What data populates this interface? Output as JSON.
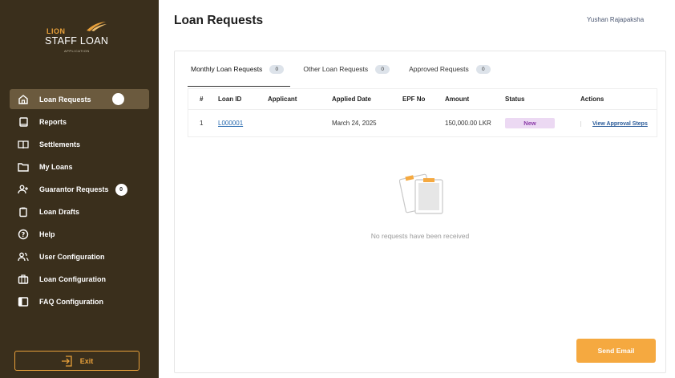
{
  "brand": {
    "top": "LION",
    "title": "STAFF  LOAN",
    "sub": "APPLICATION"
  },
  "sidebar": {
    "items": [
      {
        "label": "Loan Requests",
        "icon": "home-icon",
        "active": true
      },
      {
        "label": "Reports",
        "icon": "book-icon"
      },
      {
        "label": "Settlements",
        "icon": "open-book-icon"
      },
      {
        "label": "My Loans",
        "icon": "folder-icon"
      },
      {
        "label": "Guarantor Requests",
        "icon": "user-plus-icon",
        "badge": "0"
      },
      {
        "label": "Loan Drafts",
        "icon": "clipboard-icon"
      },
      {
        "label": "Help",
        "icon": "help-icon"
      },
      {
        "label": "User Configuration",
        "icon": "users-icon"
      },
      {
        "label": "Loan Configuration",
        "icon": "briefcase-icon"
      },
      {
        "label": "FAQ Configuration",
        "icon": "sidebar-panel-icon"
      }
    ],
    "exit_label": "Exit"
  },
  "header": {
    "title": "Loan Requests",
    "user": "Yushan Rajapaksha"
  },
  "tabs": [
    {
      "label": "Monthly Loan Requests",
      "count": "0"
    },
    {
      "label": "Other Loan Requests",
      "count": "0"
    },
    {
      "label": "Approved Requests",
      "count": "0"
    }
  ],
  "table": {
    "headers": [
      "#",
      "Loan ID",
      "Applicant",
      "Applied Date",
      "EPF No",
      "Amount",
      "Status",
      "Actions"
    ],
    "rows": [
      {
        "num": "1",
        "loan_id": "L000001",
        "applicant": "",
        "date": "March 24, 2025",
        "epf": "",
        "amount": "150,000.00 LKR",
        "status": "New",
        "action": "View Approval Steps"
      }
    ]
  },
  "empty_text": "No requests have been received",
  "send_email_label": "Send Email",
  "colors": {
    "sidebar": "#3a2f1c",
    "accent": "#f5a940",
    "status_new_bg": "#ecd9f3",
    "status_new_fg": "#8a3aa8"
  }
}
